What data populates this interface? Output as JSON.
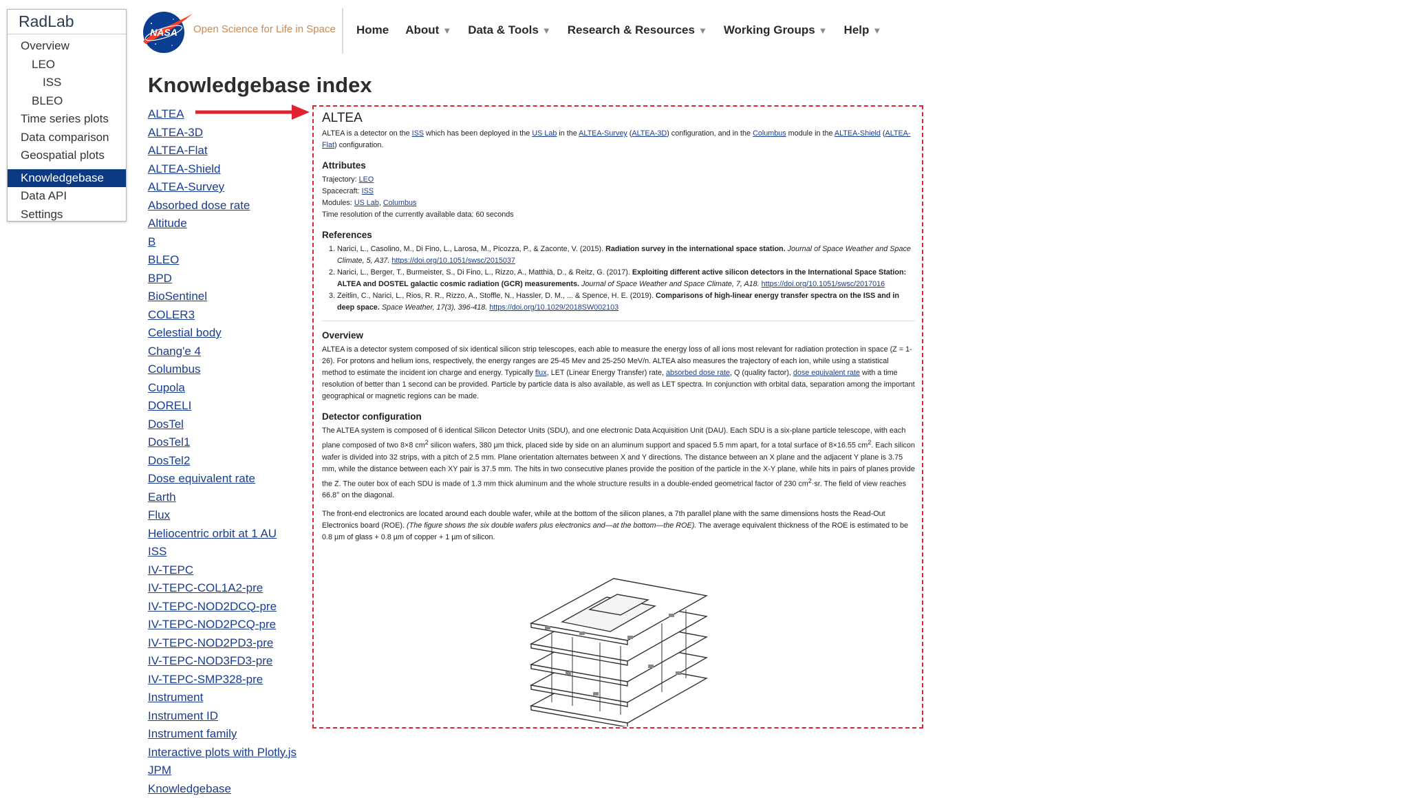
{
  "sidebar": {
    "title": "RadLab",
    "items": [
      "Overview",
      "LEO",
      "ISS",
      "BLEO",
      "Time series plots",
      "Data comparison",
      "Geospatial plots",
      "Knowledgebase",
      "Data API",
      "Settings"
    ]
  },
  "header": {
    "logo_text": "NASA",
    "tagline": "Open Science for Life in Space",
    "nav": [
      "Home",
      "About",
      "Data & Tools",
      "Research & Resources",
      "Working Groups",
      "Help"
    ]
  },
  "page": {
    "title": "Knowledgebase index",
    "entries": [
      "ALTEA",
      "ALTEA-3D",
      "ALTEA-Flat",
      "ALTEA-Shield",
      "ALTEA-Survey",
      "Absorbed dose rate",
      "Altitude",
      "B",
      "BLEO",
      "BPD",
      "BioSentinel",
      "COLER3",
      "Celestial body",
      "Chang'e 4",
      "Columbus",
      "Cupola",
      "DORELI",
      "DosTel",
      "DosTel1",
      "DosTel2",
      "Dose equivalent rate",
      "Earth",
      "Flux",
      "Heliocentric orbit at 1 AU",
      "ISS",
      "IV-TEPC",
      "IV-TEPC-COL1A2-pre",
      "IV-TEPC-NOD2DCQ-pre",
      "IV-TEPC-NOD2PCQ-pre",
      "IV-TEPC-NOD2PD3-pre",
      "IV-TEPC-NOD3FD3-pre",
      "IV-TEPC-SMP328-pre",
      "Instrument",
      "Instrument ID",
      "Instrument family",
      "Interactive plots with Plotly.js",
      "JPM",
      "Knowledgebase"
    ]
  },
  "detail": {
    "title": "ALTEA",
    "intro": {
      "t1": "ALTEA is a detector on the ",
      "l1": "ISS",
      "t2": " which has been deployed in the ",
      "l2": "US Lab",
      "t3": " in the ",
      "l3": "ALTEA-Survey",
      "t4": " (",
      "l4": "ALTEA-3D",
      "t5": ") configuration, and in the ",
      "l5": "Columbus",
      "t6": " module in the ",
      "l6": "ALTEA-Shield",
      "t7": " (",
      "l7": "ALTEA-Flat",
      "t8": ") configuration."
    },
    "attributes_heading": "Attributes",
    "attr": {
      "traj_label": "Trajectory: ",
      "traj": "LEO",
      "craft_label": "Spacecraft: ",
      "craft": "ISS",
      "mod_label": "Modules: ",
      "mod1": "US Lab",
      "mod_sep": ", ",
      "mod2": "Columbus",
      "time_res": "Time resolution of the currently available data: 60 seconds"
    },
    "references_heading": "References",
    "refs": [
      {
        "a": "Narici, L., Casolino, M., Di Fino, L., Larosa, M., Picozza, P., & Zaconte, V. (2015). ",
        "b": "Radiation survey in the international space station.",
        "c": " Journal of Space Weather and Space Climate, 5, A37. ",
        "d": "https://doi.org/10.1051/swsc/2015037"
      },
      {
        "a": "Narici, L., Berger, T., Burmeister, S., Di Fino, L., Rizzo, A., Matthiä, D., & Reitz, G. (2017). ",
        "b": "Exploiting different active silicon detectors in the International Space Station: ALTEA and DOSTEL galactic cosmic radiation (GCR) measurements.",
        "c": " Journal of Space Weather and Space Climate, 7, A18. ",
        "d": "https://doi.org/10.1051/swsc/2017016"
      },
      {
        "a": "Zeitlin, C., Narici, L., Rios, R. R., Rizzo, A., Stoffle, N., Hassler, D. M., ... & Spence, H. E. (2019). ",
        "b": "Comparisons of high-linear energy transfer spectra on the ISS and in deep space.",
        "c": " Space Weather, 17(3), 396-418. ",
        "d": "https://doi.org/10.1029/2018SW002103"
      }
    ],
    "overview_heading": "Overview",
    "overview": {
      "t1": "ALTEA is a detector system composed of six identical silicon strip telescopes, each able to measure the energy loss of all ions most relevant for radiation protection in space (Z = 1-26). For protons and helium ions, respectively, the energy ranges are 25-45 Mev and 25-250 MeV/n. ALTEA also measures the trajectory of each ion, while using a statistical method to estimate the incident ion charge and energy. Typically ",
      "l1": "flux",
      "t2": ", LET (Linear Energy Transfer) rate, ",
      "l2": "absorbed dose rate",
      "t3": ", Q (quality factor), ",
      "l3": "dose equivalent rate",
      "t4": " with a time resolution of better than 1 second can be provided. Particle by particle data is also available, as well as LET spectra. In conjunction with orbital data, separation among the important geographical or magnetic regions can be made."
    },
    "detector_heading": "Detector configuration",
    "det_p1": {
      "t1": "The ALTEA system is composed of 6 identical Silicon Detector Units (SDU), and one electronic Data Acquisition Unit (DAU). Each SDU is a six-plane particle telescope, with each plane composed of two 8×8 cm",
      "s1": "2",
      "t2": " silicon wafers, 380 µm thick, placed side by side on an aluminum support and spaced 5.5 mm apart, for a total surface of 8×16.55 cm",
      "s2": "2",
      "t3": ". Each silicon wafer is divided into 32 strips, with a pitch of 2.5 mm. Plane orientation alternates between X and Y directions. The distance between an X plane and the adjacent Y plane is 3.75 mm, while the distance between each XY pair is 37.5 mm. The hits in two consecutive planes provide the position of the particle in the X-Y plane, while hits in pairs of planes provide the Z. The outer box of each SDU is made of 1.3 mm thick aluminum and the whole structure results in a double-ended geometrical factor of 230 cm",
      "s3": "2",
      "t4": "·sr. The field of view reaches 66.8° on the diagonal."
    },
    "det_p2": {
      "t1": "The front-end electronics are located around each double wafer, while at the bottom of the silicon planes, a 7th parallel plane with the same dimensions hosts the Read-Out Electronics board (ROE). ",
      "i1": "(The figure shows the six double wafers plus electronics and—at the bottom—the ROE).",
      "t2": " The average equivalent thickness of the ROE is estimated to be 0.8 µm of glass + 0.8 µm of copper + 1 µm of silicon."
    }
  },
  "colors": {
    "accent": "#0b3a82",
    "link": "#1a3d8f",
    "highlight_border": "#e0232e",
    "arrow": "#e0232e",
    "tagline": "#c98a52"
  }
}
